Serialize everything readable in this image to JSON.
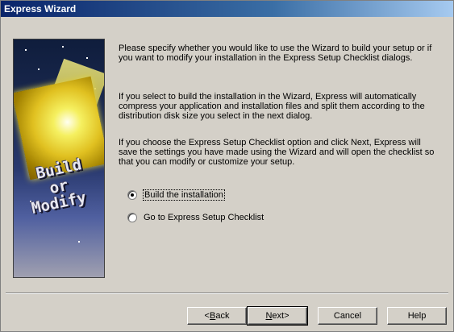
{
  "window": {
    "title": "Express Wizard"
  },
  "graphic": {
    "text_line1": "Build",
    "text_line2": "or",
    "text_line3": "Modify"
  },
  "intro": {
    "paragraph1": "Please specify whether you would like to use the Wizard to build your setup or if you want to modify your installation in the Express Setup Checklist dialogs.",
    "paragraph2": "If you select to build the installation in the Wizard, Express will automatically compress your application and installation files and split them according to the distribution disk size you select in the next dialog.",
    "paragraph3": "If you choose the Express Setup Checklist option and click Next, Express will save the settings you have made using the Wizard and will open the checklist so that you can modify or customize your setup."
  },
  "options": [
    {
      "label": "Build the installation",
      "selected": true
    },
    {
      "label": "Go to Express Setup Checklist",
      "selected": false
    }
  ],
  "buttons": {
    "back_mnemonic": "B",
    "back_rest": "ack",
    "back_prefix": "< ",
    "next_mnemonic": "N",
    "next_rest": "ext",
    "next_suffix": " >",
    "cancel": "Cancel",
    "help": "Help"
  }
}
